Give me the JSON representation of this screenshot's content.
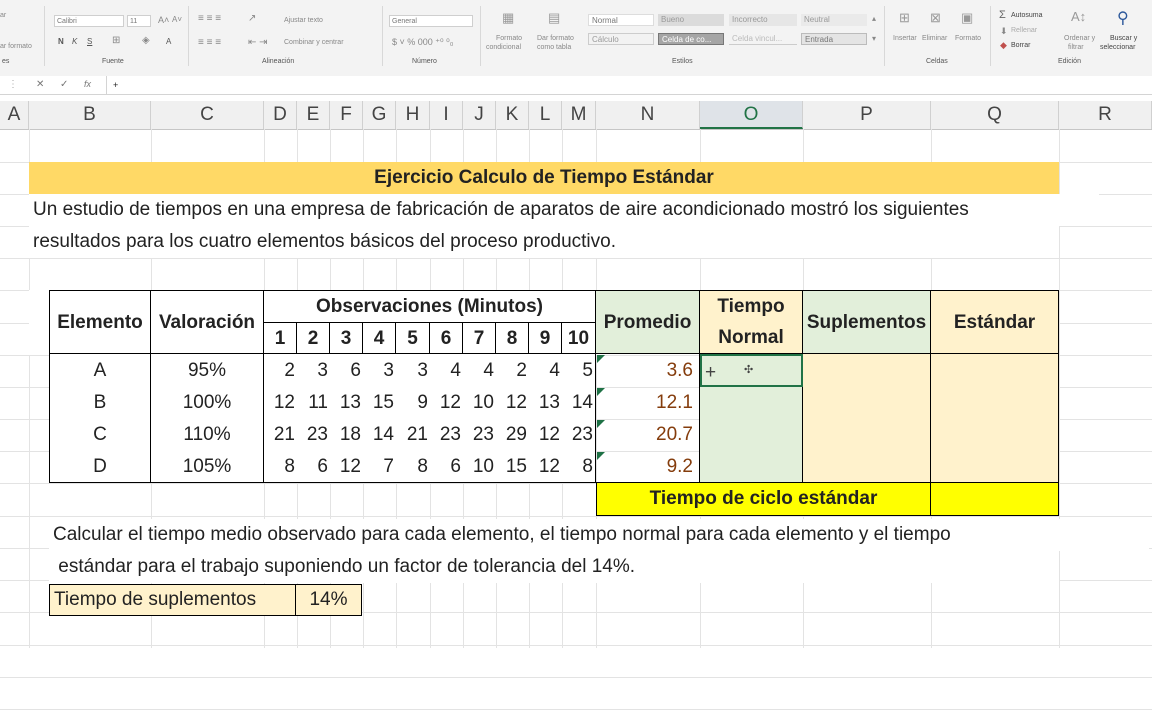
{
  "ribbon": {
    "clipboard": {
      "label_a": "ar",
      "label_b": "ar formato",
      "group": "es"
    },
    "font": {
      "family": "Calibri",
      "size": "11",
      "bold": "N",
      "italic": "K",
      "underline": "S",
      "color_a": "A",
      "group": "Fuente"
    },
    "alignment": {
      "wrap": "Ajustar texto",
      "merge": "Combinar y centrar",
      "group": "Alineación"
    },
    "number": {
      "format": "General",
      "group": "Número"
    },
    "styles": {
      "cond": [
        "Formato",
        "condicional"
      ],
      "table": [
        "Dar formato",
        "como tabla"
      ],
      "boxes": [
        "Normal",
        "Bueno",
        "Incorrecto",
        "Neutral",
        "Cálculo",
        "Celda de co...",
        "Celda vincul...",
        "Entrada"
      ],
      "group": "Estilos"
    },
    "cells": {
      "insert": "Insertar",
      "delete": "Eliminar",
      "format": "Formato",
      "group": "Celdas"
    },
    "edit": {
      "autosum": "Autosuma",
      "fill": "Rellenar",
      "clear": "Borrar",
      "sort": [
        "Ordenar y",
        "filtrar"
      ],
      "find": [
        "Buscar y",
        "seleccionar"
      ],
      "group": "Edición"
    }
  },
  "formula_bar": {
    "cancel": "✕",
    "enter": "✓",
    "fx": "fx",
    "content": "+"
  },
  "columns": [
    "A",
    "B",
    "C",
    "D",
    "E",
    "F",
    "G",
    "H",
    "I",
    "J",
    "K",
    "L",
    "M",
    "N",
    "O",
    "P",
    "Q",
    "R"
  ],
  "sheet": {
    "title": "Ejercicio Calculo de Tiempo Estándar",
    "intro_1": "Un estudio de tiempos en una empresa de fabricación de aparatos de aire acondicionado mostró los siguientes",
    "intro_2": "resultados para los cuatro elementos básicos del proceso productivo.",
    "headers": {
      "elemento": "Elemento",
      "valoracion": "Valoración",
      "observaciones": "Observaciones (Minutos)",
      "promedio": "Promedio",
      "tiempo_normal_1": "Tiempo",
      "tiempo_normal_2": "Normal",
      "suplementos": "Suplementos",
      "estandar": "Estándar"
    },
    "obs_numbers": [
      "1",
      "2",
      "3",
      "4",
      "5",
      "6",
      "7",
      "8",
      "9",
      "10"
    ],
    "rows": [
      {
        "el": "A",
        "val": "95%",
        "obs": [
          "2",
          "3",
          "6",
          "3",
          "3",
          "4",
          "4",
          "2",
          "4",
          "5"
        ],
        "prom": "3.6",
        "normal": "+"
      },
      {
        "el": "B",
        "val": "100%",
        "obs": [
          "12",
          "11",
          "13",
          "15",
          "9",
          "12",
          "10",
          "12",
          "13",
          "14"
        ],
        "prom": "12.1",
        "normal": ""
      },
      {
        "el": "C",
        "val": "110%",
        "obs": [
          "21",
          "23",
          "18",
          "14",
          "21",
          "23",
          "23",
          "29",
          "12",
          "23"
        ],
        "prom": "20.7",
        "normal": ""
      },
      {
        "el": "D",
        "val": "105%",
        "obs": [
          "8",
          "6",
          "12",
          "7",
          "8",
          "6",
          "10",
          "15",
          "12",
          "8"
        ],
        "prom": "9.2",
        "normal": ""
      }
    ],
    "ciclo": "Tiempo de ciclo estándar",
    "calc_1": "Calcular el tiempo medio observado para cada elemento, el tiempo normal para cada elemento y el tiempo",
    "calc_2": " estándar para el trabajo suponiendo un factor de tolerancia del 14%.",
    "supl_label": "Tiempo de suplementos",
    "supl_value": "14%"
  },
  "colors": {
    "title_bg": "#ffd966",
    "green_bg": "#e2efda",
    "cream_bg": "#fff2cc",
    "yellow_bg": "#ffff00",
    "promedio_text": "#843c0c",
    "selected": "#217346"
  }
}
